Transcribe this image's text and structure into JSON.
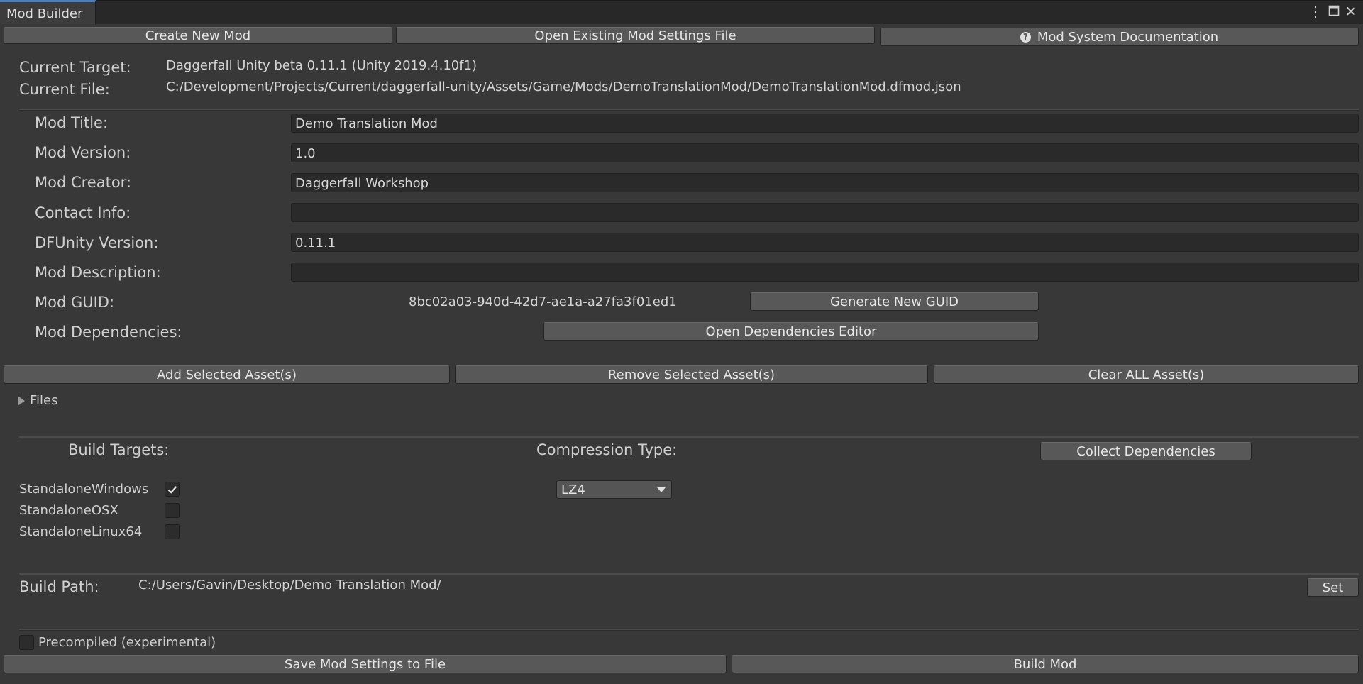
{
  "window": {
    "tab_title": "Mod Builder",
    "controls": [
      "more-icon",
      "maximize-icon",
      "close-icon"
    ]
  },
  "toolbar": {
    "create_new_mod": "Create New Mod",
    "open_existing": "Open Existing Mod Settings File",
    "documentation": "Mod System Documentation"
  },
  "target": {
    "current_target_label": "Current Target:",
    "current_target_value": "Daggerfall Unity beta 0.11.1 (Unity 2019.4.10f1)",
    "current_file_label": "Current File:",
    "current_file_value": "C:/Development/Projects/Current/daggerfall-unity/Assets/Game/Mods/DemoTranslationMod/DemoTranslationMod.dfmod.json"
  },
  "mod": {
    "title_label": "Mod Title:",
    "title_value": "Demo Translation Mod",
    "version_label": "Mod Version:",
    "version_value": "1.0",
    "creator_label": "Mod Creator:",
    "creator_value": "Daggerfall Workshop",
    "contact_label": "Contact Info:",
    "contact_value": "",
    "dfunity_label": "DFUnity Version:",
    "dfunity_value": "0.11.1",
    "description_label": "Mod Description:",
    "description_value": "",
    "guid_label": "Mod GUID:",
    "guid_value": "8bc02a03-940d-42d7-ae1a-a27fa3f01ed1",
    "generate_guid": "Generate New GUID",
    "dependencies_label": "Mod Dependencies:",
    "open_dependencies": "Open Dependencies Editor"
  },
  "assets": {
    "add_selected": "Add Selected Asset(s)",
    "remove_selected": "Remove Selected Asset(s)",
    "clear_all": "Clear ALL Asset(s)",
    "files_foldout": "Files"
  },
  "build": {
    "targets_label": "Build Targets:",
    "compression_label": "Compression Type:",
    "collect_dependencies": "Collect Dependencies",
    "targets": [
      {
        "name": "StandaloneWindows",
        "checked": true
      },
      {
        "name": "StandaloneOSX",
        "checked": false
      },
      {
        "name": "StandaloneLinux64",
        "checked": false
      }
    ],
    "compression_value": "LZ4",
    "path_label": "Build Path:",
    "path_value": "C:/Users/Gavin/Desktop/Demo Translation Mod/",
    "set_button": "Set",
    "precompiled_label": "Precompiled (experimental)",
    "precompiled_checked": false,
    "save_settings": "Save Mod Settings to File",
    "build_mod": "Build Mod"
  }
}
